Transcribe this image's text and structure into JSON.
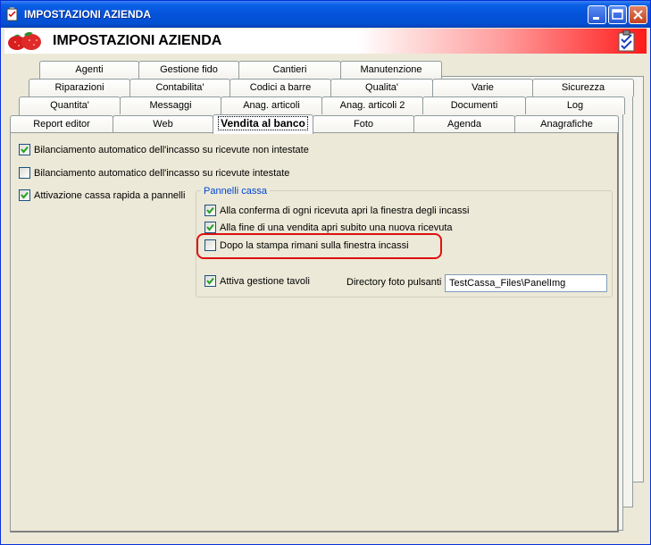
{
  "window": {
    "title": "IMPOSTAZIONI AZIENDA"
  },
  "header": {
    "title": "IMPOSTAZIONI AZIENDA"
  },
  "tabs": {
    "row1": [
      "Agenti",
      "Gestione fido",
      "Cantieri",
      "Manutenzione"
    ],
    "row2": [
      "Riparazioni",
      "Contabilita'",
      "Codici a barre",
      "Qualita'",
      "Varie",
      "Sicurezza"
    ],
    "row3": [
      "Quantita'",
      "Messaggi",
      "Anag. articoli",
      "Anag. articoli 2",
      "Documenti",
      "Log"
    ],
    "row4": [
      "Report editor",
      "Web",
      "Vendita al banco",
      "Foto",
      "Agenda",
      "Anagrafiche"
    ],
    "active": "Vendita al banco"
  },
  "options": {
    "bilanciamento_non_intestate": {
      "label": "Bilanciamento automatico dell'incasso su ricevute non intestate",
      "checked": true
    },
    "bilanciamento_intestate": {
      "label": "Bilanciamento automatico dell'incasso su ricevute intestate",
      "checked": false
    },
    "cassa_rapida": {
      "label": "Attivazione cassa rapida a pannelli",
      "checked": true
    }
  },
  "pannelli": {
    "group_label": "Pannelli cassa",
    "conferma": {
      "label": "Alla conferma di ogni ricevuta apri la finestra degli incassi",
      "checked": true
    },
    "fine_vendita": {
      "label": "Alla fine di una vendita apri subito una nuova ricevuta",
      "checked": true
    },
    "dopo_stampa": {
      "label": "Dopo la stampa rimani sulla finestra incassi",
      "checked": false
    },
    "gestione_tavoli": {
      "label": "Attiva gestione tavoli",
      "checked": true
    },
    "directory_label": "Directory foto pulsanti :",
    "directory_value": "TestCassa_Files\\PanelImg"
  },
  "colors": {
    "titlebar": "#0453d9",
    "accent_highlight": "#e01010",
    "group_label": "#0046d5"
  }
}
